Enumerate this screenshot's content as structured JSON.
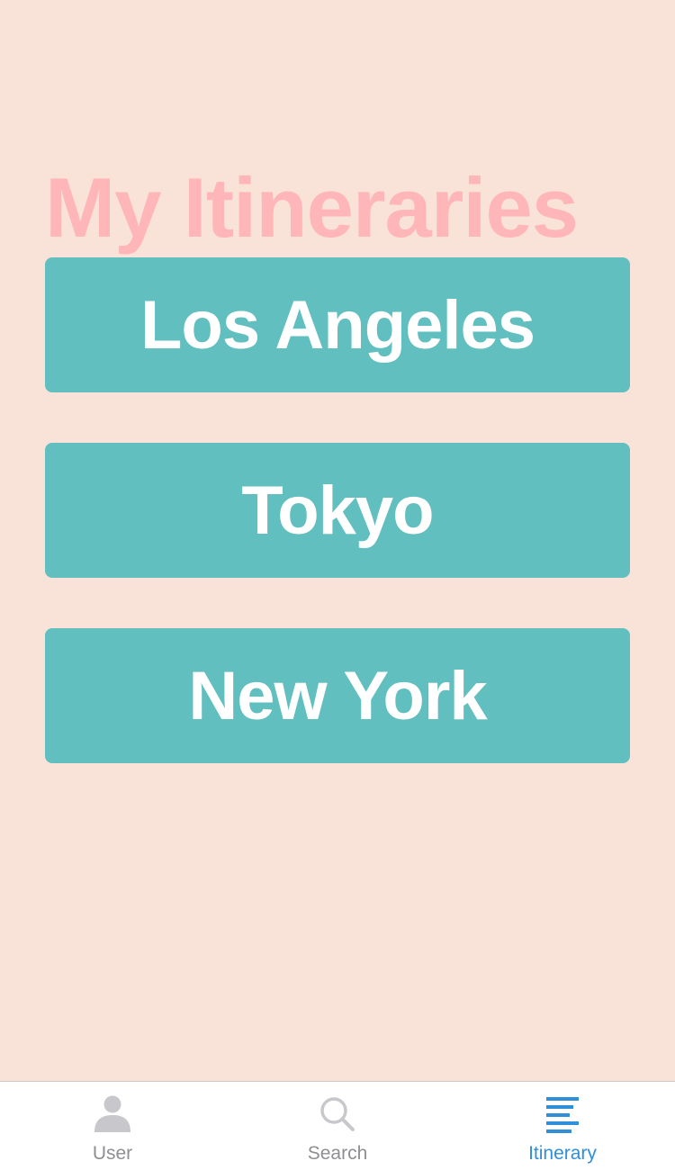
{
  "page": {
    "title": "My Itineraries"
  },
  "itineraries": [
    {
      "label": "Los Angeles"
    },
    {
      "label": "Tokyo"
    },
    {
      "label": "New York"
    }
  ],
  "tab_bar": {
    "active_tab": "Itinerary",
    "tabs": [
      {
        "label": "User",
        "icon": "user-icon"
      },
      {
        "label": "Search",
        "icon": "search-icon"
      },
      {
        "label": "Itinerary",
        "icon": "list-icon"
      }
    ]
  },
  "colors": {
    "background": "#f9e3d9",
    "title": "#ffb6b9",
    "button": "#62bfbf",
    "button_text": "#ffffff",
    "tab_inactive": "#8e8e93",
    "tab_active": "#2f8fd8"
  }
}
